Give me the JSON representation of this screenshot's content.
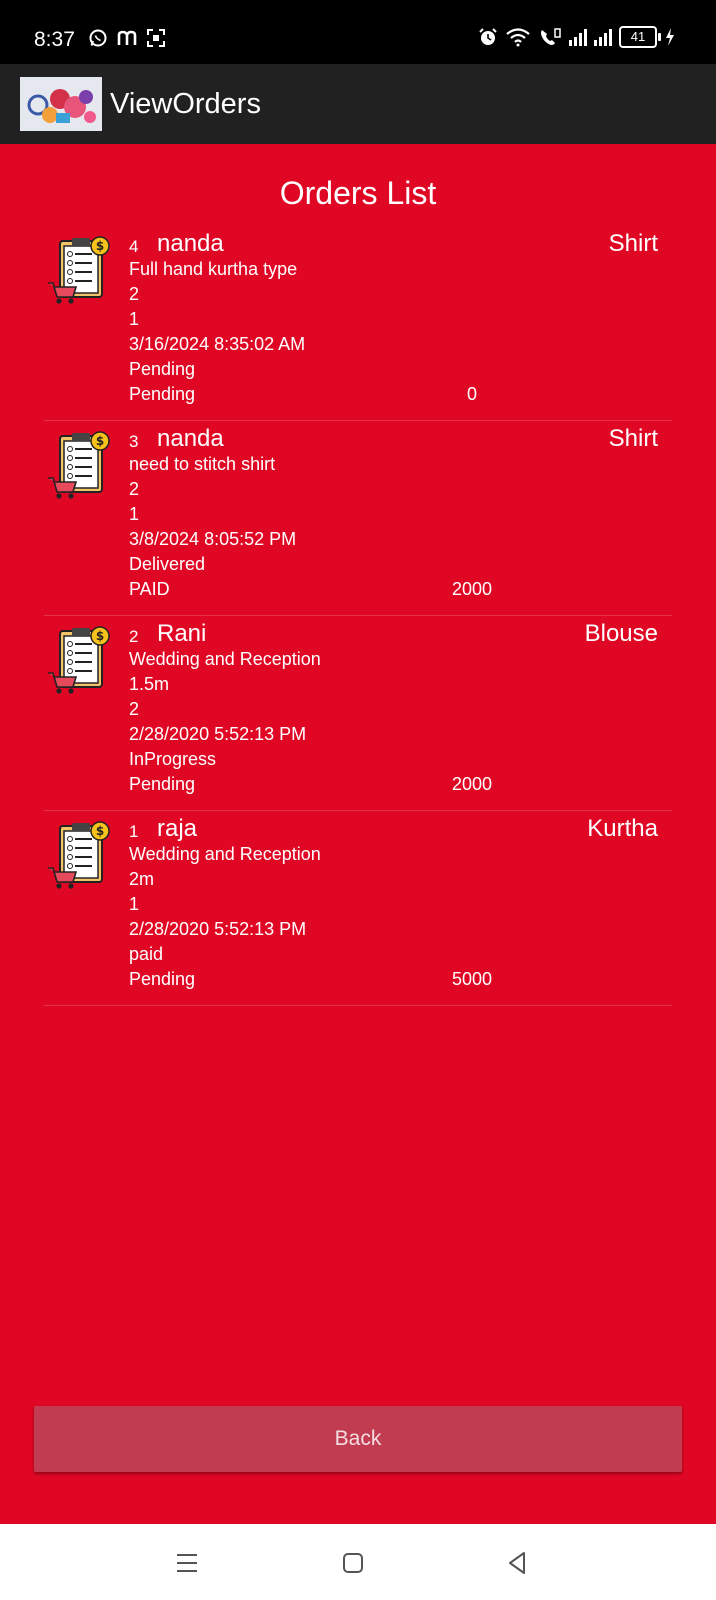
{
  "status_bar": {
    "time": "8:37",
    "battery": "41"
  },
  "app_bar": {
    "title": "ViewOrders"
  },
  "page": {
    "title": "Orders List"
  },
  "orders": [
    {
      "id": "4",
      "name": "nanda",
      "type": "Shirt",
      "description": "Full hand kurtha type",
      "line2": "2",
      "line3": "1",
      "datetime": "3/16/2024 8:35:02 AM",
      "status": "Pending",
      "payment": "Pending",
      "amount": "0"
    },
    {
      "id": "3",
      "name": "nanda",
      "type": "Shirt",
      "description": "need to stitch shirt",
      "line2": "2",
      "line3": "1",
      "datetime": "3/8/2024 8:05:52 PM",
      "status": "Delivered",
      "payment": "PAID",
      "amount": "2000"
    },
    {
      "id": "2",
      "name": "Rani",
      "type": "Blouse",
      "description": "Wedding and Reception",
      "line2": "1.5m",
      "line3": "2",
      "datetime": "2/28/2020 5:52:13 PM",
      "status": "InProgress",
      "payment": "Pending",
      "amount": "2000"
    },
    {
      "id": "1",
      "name": "raja",
      "type": "Kurtha",
      "description": "Wedding and Reception",
      "line2": "2m",
      "line3": "1",
      "datetime": "2/28/2020 5:52:13 PM",
      "status": "paid",
      "payment": "Pending",
      "amount": "5000"
    }
  ],
  "actions": {
    "back_label": "Back"
  },
  "colors": {
    "background": "#e00724",
    "app_bar": "#212121",
    "back_button": "#c13c50"
  }
}
